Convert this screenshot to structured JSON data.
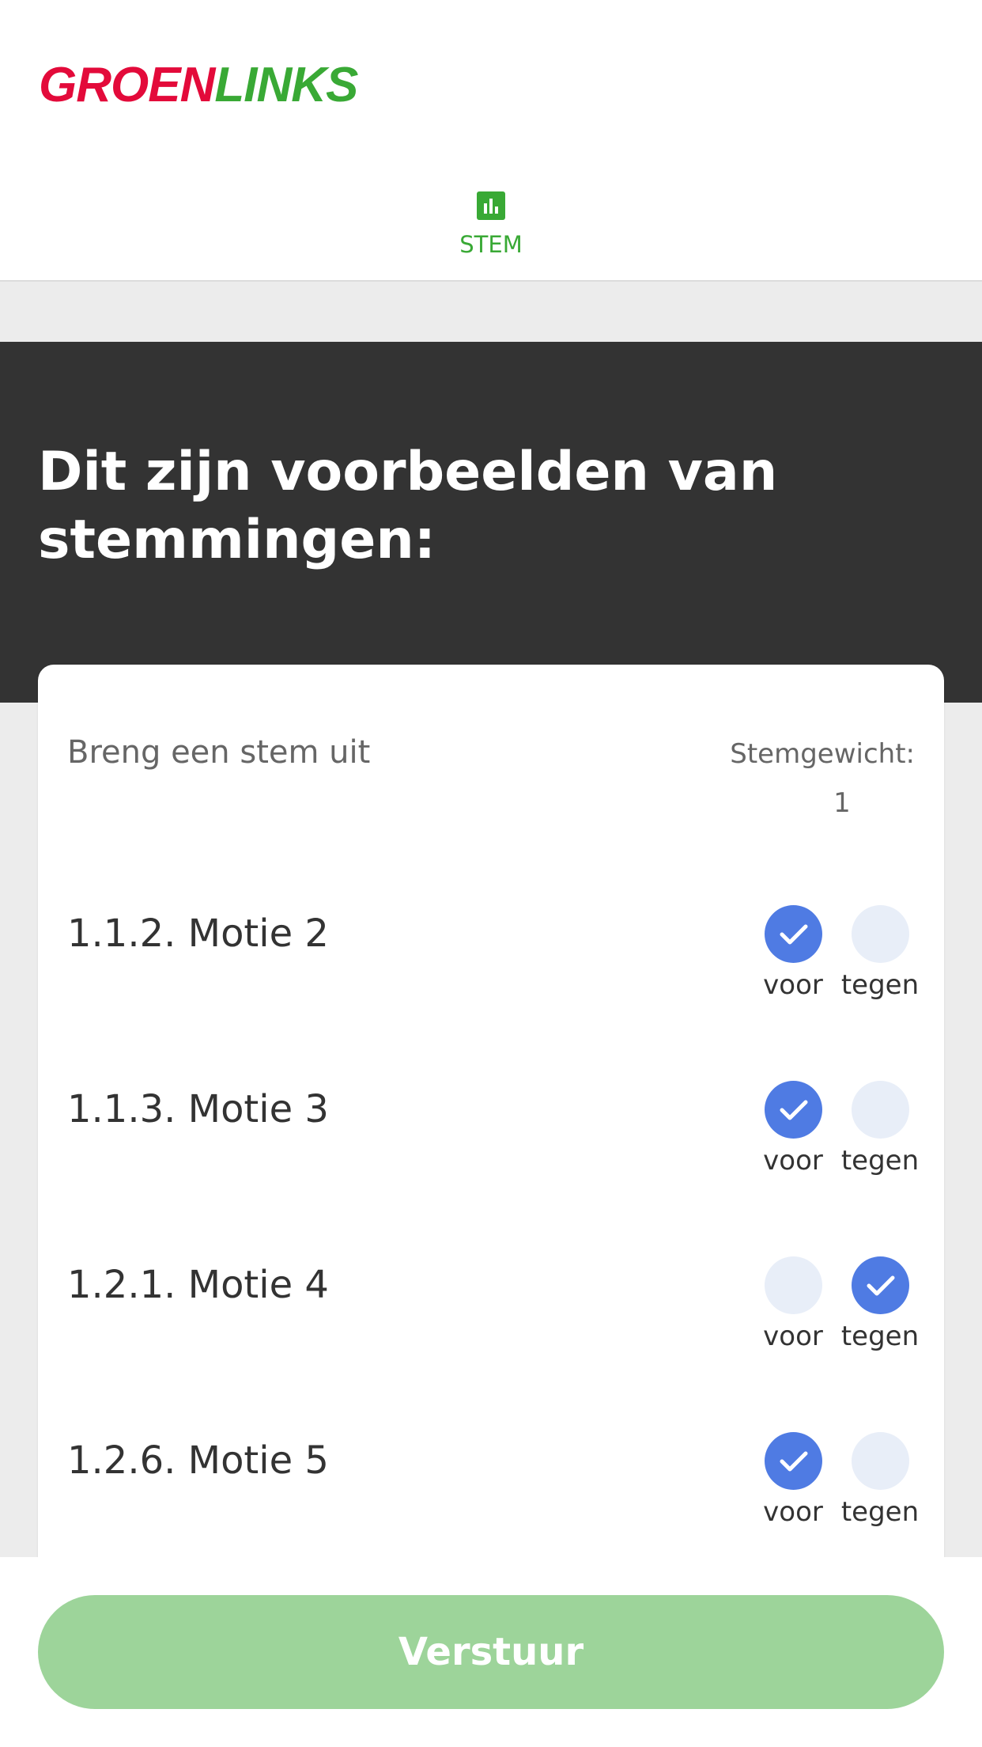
{
  "header": {
    "logo_part1": "GROEN",
    "logo_part2": "LINKS",
    "tab": {
      "label": "STEM",
      "icon": "bar-chart-icon"
    }
  },
  "hero": {
    "title": "Dit zijn voorbeelden van stemmingen:"
  },
  "card": {
    "intro": "Breng een stem uit",
    "weight_label": "Stemgewicht:",
    "weight_value": "1",
    "motions": [
      {
        "title": "1.1.2. Motie 2",
        "voor_label": "voor",
        "tegen_label": "tegen",
        "selected": "voor"
      },
      {
        "title": "1.1.3. Motie 3",
        "voor_label": "voor",
        "tegen_label": "tegen",
        "selected": "voor"
      },
      {
        "title": "1.2.1. Motie 4",
        "voor_label": "voor",
        "tegen_label": "tegen",
        "selected": "tegen"
      },
      {
        "title": "1.2.6. Motie 5",
        "voor_label": "voor",
        "tegen_label": "tegen",
        "selected": "voor"
      }
    ]
  },
  "footer": {
    "submit_label": "Verstuur"
  },
  "colors": {
    "brand_red": "#e30a3a",
    "brand_green": "#39a935",
    "hero_bg": "#333333",
    "radio_checked": "#4f7be3",
    "radio_unchecked": "#e8eef8",
    "submit_bg": "#9dd49a"
  }
}
